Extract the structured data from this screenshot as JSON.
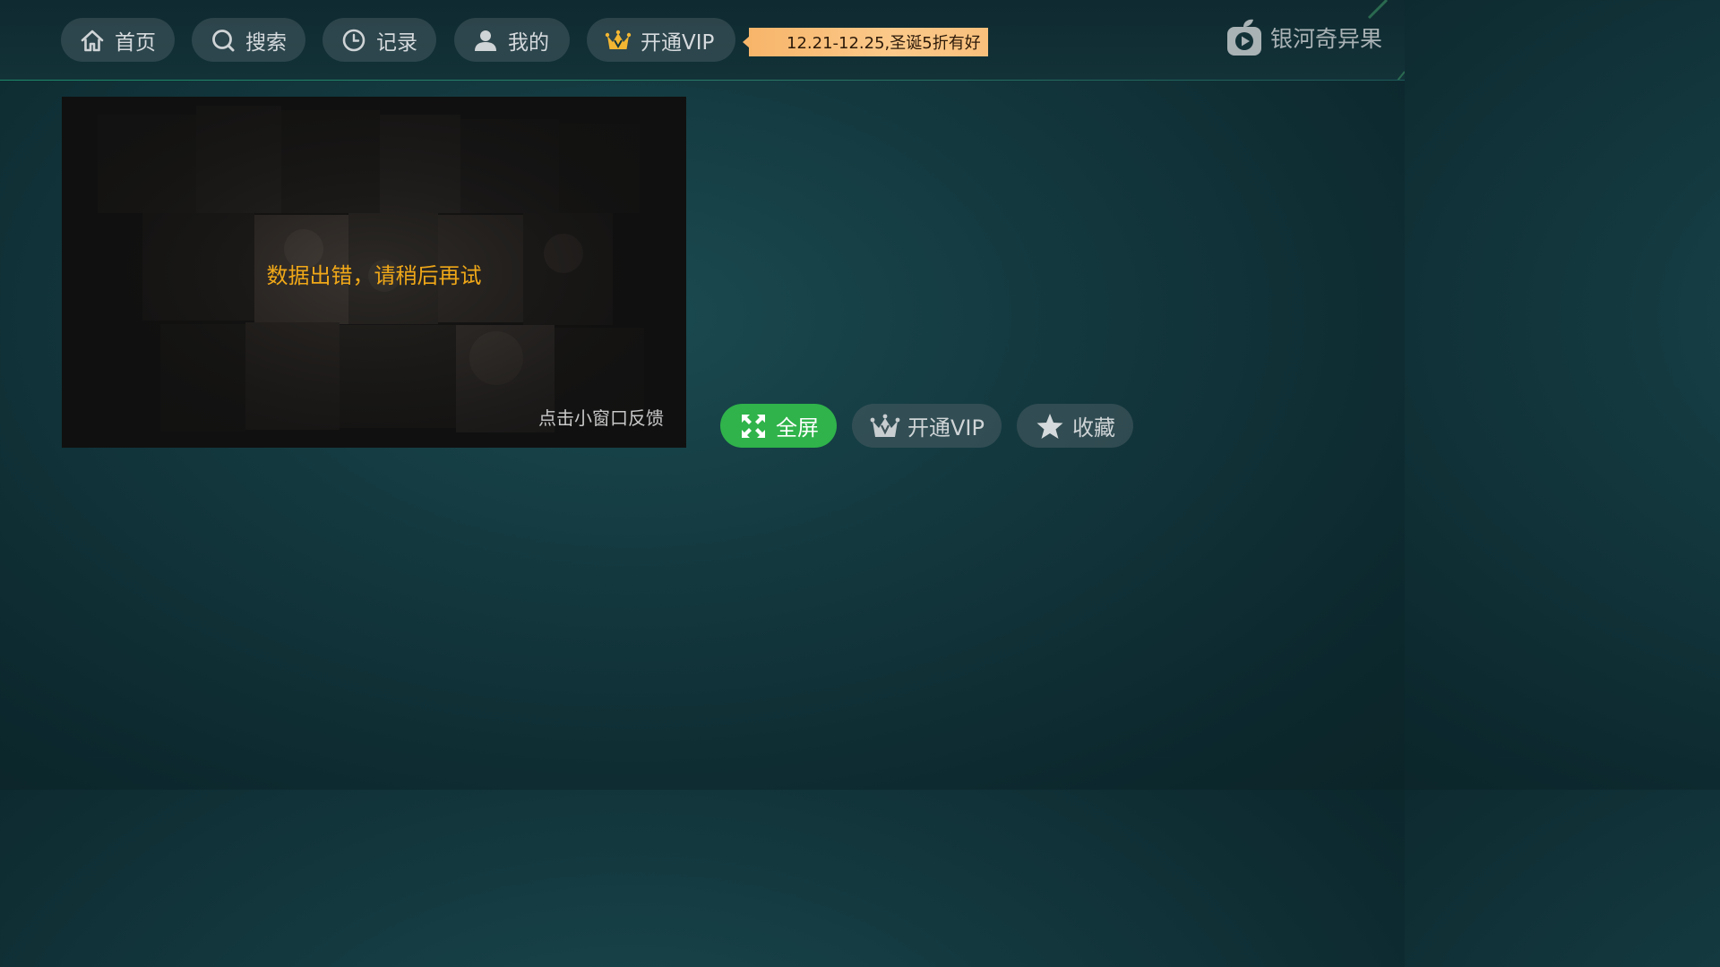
{
  "nav": {
    "items": [
      {
        "label": "首页",
        "icon": "home-icon"
      },
      {
        "label": "搜索",
        "icon": "search-icon"
      },
      {
        "label": "记录",
        "icon": "clock-icon"
      },
      {
        "label": "我的",
        "icon": "user-icon"
      },
      {
        "label": "开通VIP",
        "icon": "crown-icon"
      }
    ],
    "promo": "12.21-12.25,圣诞5折有好",
    "brand": "银河奇异果"
  },
  "player": {
    "error_message": "数据出错，请稍后再试",
    "feedback_hint": "点击小窗口反馈"
  },
  "actions": {
    "fullscreen_label": "全屏",
    "vip_label": "开通VIP",
    "favorite_label": "收藏"
  },
  "colors": {
    "accent_green": "#2fb34a",
    "error_orange": "#f0a818",
    "promo_orange": "#f9c07c"
  }
}
